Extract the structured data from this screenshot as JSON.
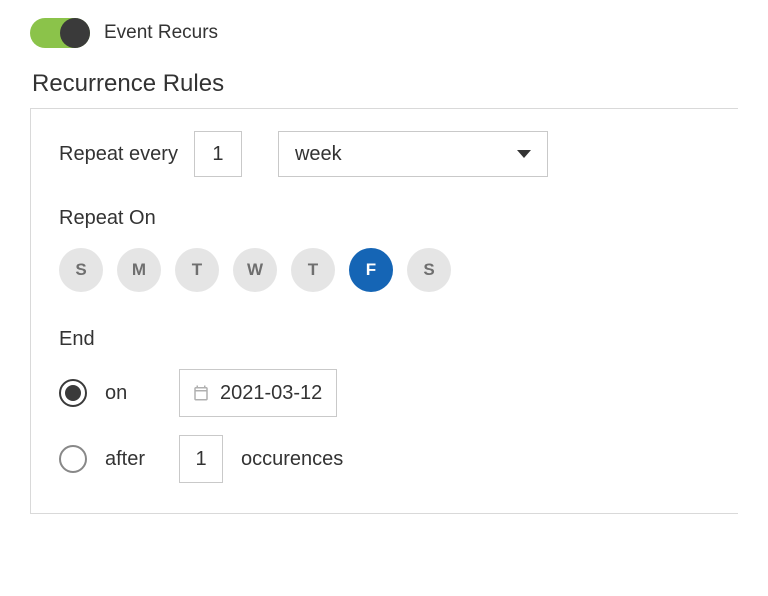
{
  "toggle": {
    "on": true,
    "label": "Event Recurs"
  },
  "section_title": "Recurrence Rules",
  "repeat": {
    "every_label": "Repeat every",
    "interval": "1",
    "unit": "week"
  },
  "repeat_on": {
    "label": "Repeat On",
    "days": [
      {
        "abbr": "S",
        "selected": false
      },
      {
        "abbr": "M",
        "selected": false
      },
      {
        "abbr": "T",
        "selected": false
      },
      {
        "abbr": "W",
        "selected": false
      },
      {
        "abbr": "T",
        "selected": false
      },
      {
        "abbr": "F",
        "selected": true
      },
      {
        "abbr": "S",
        "selected": false
      }
    ]
  },
  "end": {
    "label": "End",
    "on": {
      "label": "on",
      "selected": true,
      "date": "2021-03-12"
    },
    "after": {
      "label": "after",
      "selected": false,
      "count": "1",
      "suffix": "occurences"
    }
  }
}
